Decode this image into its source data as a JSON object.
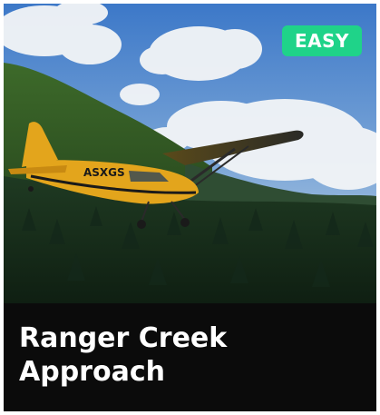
{
  "card": {
    "title": "Ranger Creek Approach",
    "difficulty": "EASY",
    "difficulty_color": "#1fd389",
    "image_description_name": "aircraft-photo",
    "aircraft_registration": "ASXGS"
  }
}
